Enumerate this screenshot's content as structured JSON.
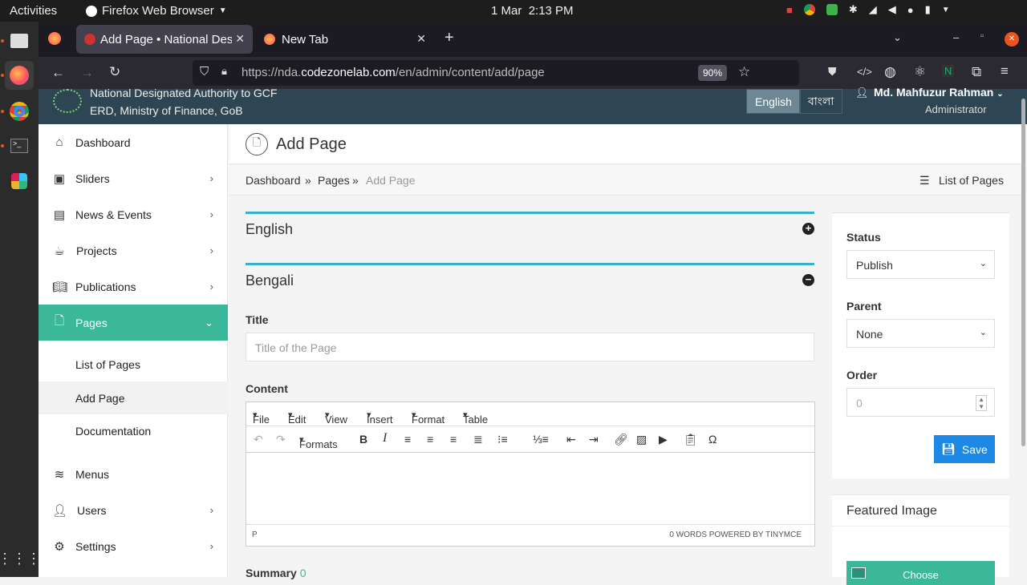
{
  "system_bar": {
    "activities": "Activities",
    "app_name": "Firefox Web Browser",
    "date": "1 Mar",
    "time": "2:13 PM"
  },
  "browser": {
    "tabs": [
      {
        "label": "Add Page • National Desig",
        "active": true
      },
      {
        "label": "New Tab",
        "active": false
      }
    ],
    "url_prefix": "https://nda.",
    "url_domain": "codezonelab.com",
    "url_path": "/en/admin/content/add/page",
    "zoom": "90%"
  },
  "site": {
    "title_line1": "National Designated Authority to GCF",
    "title_line2": "ERD, Ministry of Finance, GoB",
    "lang_en": "English",
    "lang_bn": "বাংলা",
    "user_name": "Md. Mahfuzur Rahman",
    "user_role": "Administrator"
  },
  "sidebar": {
    "items": [
      {
        "label": "Dashboard",
        "icon": "home-icon"
      },
      {
        "label": "Sliders",
        "icon": "slider-icon"
      },
      {
        "label": "News & Events",
        "icon": "newspaper-icon"
      },
      {
        "label": "Projects",
        "icon": "coffee-icon"
      },
      {
        "label": "Publications",
        "icon": "book-icon"
      },
      {
        "label": "Pages",
        "icon": "file-icon"
      },
      {
        "label": "Menus",
        "icon": "layers-icon"
      },
      {
        "label": "Users",
        "icon": "users-icon"
      },
      {
        "label": "Settings",
        "icon": "gear-icon"
      }
    ],
    "sub_items": [
      "List of Pages",
      "Add Page",
      "Documentation"
    ]
  },
  "page": {
    "title": "Add Page",
    "breadcrumb": [
      "Dashboard",
      "Pages",
      "Add Page"
    ],
    "breadcrumb_sep": "»",
    "list_link": "List of Pages",
    "panel_english": "English",
    "panel_bengali": "Bengali",
    "title_label": "Title",
    "title_placeholder": "Title of the Page",
    "content_label": "Content",
    "summary_label": "Summary",
    "summary_count": "0"
  },
  "editor": {
    "menus": [
      "File",
      "Edit",
      "View",
      "Insert",
      "Format",
      "Table"
    ],
    "formats_label": "Formats",
    "path": "P",
    "status": "0 WORDS POWERED BY TINYMCE"
  },
  "side": {
    "status_label": "Status",
    "status_value": "Publish",
    "parent_label": "Parent",
    "parent_value": "None",
    "order_label": "Order",
    "order_placeholder": "0",
    "save_label": "Save",
    "featured_label": "Featured Image",
    "choose_label": "Choose"
  },
  "colors": {
    "accent": "#3bb79a",
    "header": "#2e4553",
    "primary": "#1e88e5",
    "panel_border": "#3bb0c9"
  }
}
